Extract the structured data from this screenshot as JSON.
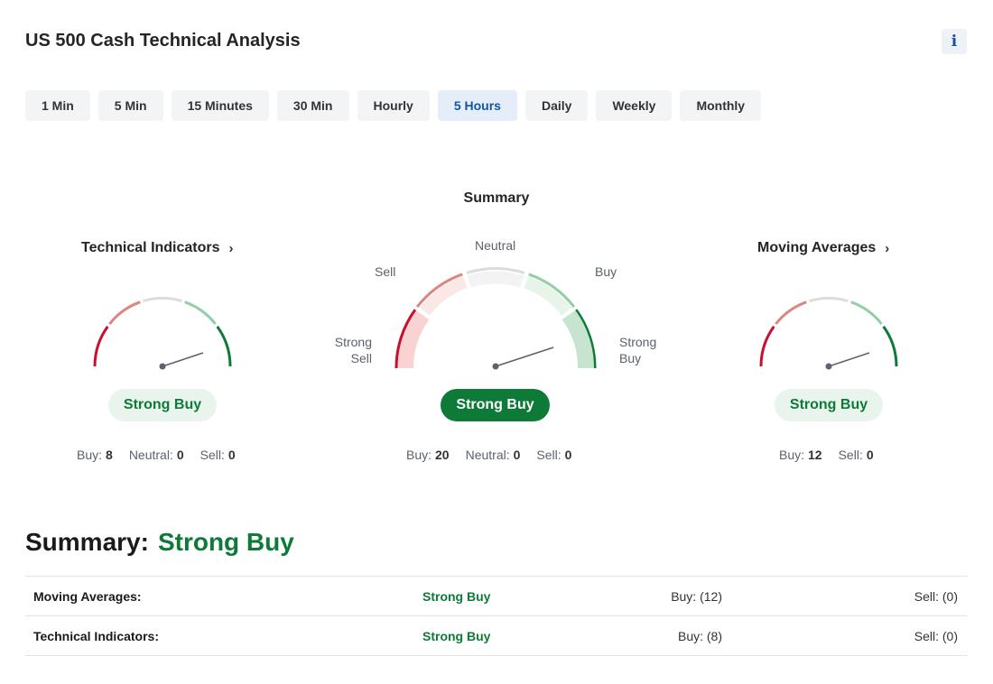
{
  "header": {
    "title": "US 500 Cash Technical Analysis",
    "info_label": "i"
  },
  "tabs": [
    {
      "label": "1 Min"
    },
    {
      "label": "5 Min"
    },
    {
      "label": "15 Minutes"
    },
    {
      "label": "30 Min"
    },
    {
      "label": "Hourly"
    },
    {
      "label": "5 Hours",
      "active": true
    },
    {
      "label": "Daily"
    },
    {
      "label": "Weekly"
    },
    {
      "label": "Monthly"
    }
  ],
  "summary_heading": "Summary",
  "gauges": {
    "technical": {
      "title": "Technical Indicators",
      "verdict": "Strong Buy",
      "buy_label": "Buy:",
      "buy": "8",
      "neutral_label": "Neutral:",
      "neutral": "0",
      "sell_label": "Sell:",
      "sell": "0"
    },
    "summary": {
      "verdict": "Strong Buy",
      "buy_label": "Buy:",
      "buy": "20",
      "neutral_label": "Neutral:",
      "neutral": "0",
      "sell_label": "Sell:",
      "sell": "0",
      "labels": {
        "strong_sell_1": "Strong",
        "strong_sell_2": "Sell",
        "sell": "Sell",
        "neutral": "Neutral",
        "buy": "Buy",
        "strong_buy_1": "Strong",
        "strong_buy_2": "Buy"
      }
    },
    "moving": {
      "title": "Moving Averages",
      "verdict": "Strong Buy",
      "buy_label": "Buy:",
      "buy": "12",
      "sell_label": "Sell:",
      "sell": "0"
    }
  },
  "colors": {
    "strong_sell": "#c8102e",
    "sell": "#d98780",
    "neutral": "#dcdcdc",
    "buy": "#93cfa6",
    "strong_buy": "#0d7a37",
    "needle": "#5b616e"
  },
  "bottom": {
    "label": "Summary:",
    "value": "Strong Buy",
    "rows": [
      {
        "name": "Moving Averages:",
        "verdict": "Strong Buy",
        "buy": "Buy: (12)",
        "sell": "Sell: (0)"
      },
      {
        "name": "Technical Indicators:",
        "verdict": "Strong Buy",
        "buy": "Buy: (8)",
        "sell": "Sell: (0)"
      }
    ]
  }
}
